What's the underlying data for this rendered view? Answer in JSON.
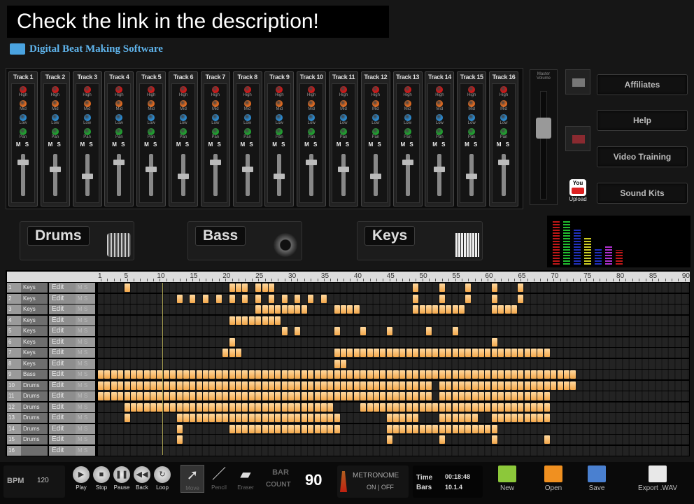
{
  "banner": "Check the link in the description!",
  "app_title": "Digital Beat Making Software",
  "mixer": {
    "tracks": [
      "Track 1",
      "Track 2",
      "Track 3",
      "Track 4",
      "Track 5",
      "Track 6",
      "Track 7",
      "Track 8",
      "Track 9",
      "Track 10",
      "Track 11",
      "Track 12",
      "Track 13",
      "Track 14",
      "Track 15",
      "Track 16"
    ],
    "knobs": [
      "High",
      "Mid",
      "Low",
      "Pan"
    ],
    "knob_colors": [
      "#d01818",
      "#e06a20",
      "#2a8ad0",
      "#20a030"
    ],
    "ms": "M S",
    "master_label": "Master Volume"
  },
  "menu": [
    "Affiliates",
    "Help",
    "Video Training",
    "Sound Kits"
  ],
  "upload": {
    "icon": "You",
    "label": "Upload"
  },
  "instruments": [
    "Drums",
    "Bass",
    "Keys"
  ],
  "spectrum": {
    "levels": [
      0.88,
      0.9,
      0.75,
      0.55,
      0.35,
      0.4,
      0.3
    ],
    "colors": [
      "#c01818",
      "#20c030",
      "#2030c0",
      "#d0d020",
      "#2030c0",
      "#b030d0",
      "#c01818"
    ]
  },
  "sequencer": {
    "ruler_ticks": [
      "1",
      "5",
      "10",
      "15",
      "20",
      "25",
      "30",
      "35",
      "40",
      "45",
      "50",
      "55",
      "60",
      "65",
      "70",
      "75",
      "80",
      "85",
      "90"
    ],
    "edit_label": "Edit",
    "ms_label": "M S",
    "tracks": [
      {
        "num": "1",
        "name": "Keys",
        "notes": [
          5,
          21,
          22,
          23,
          25,
          26,
          27,
          49,
          53,
          57,
          61,
          65
        ]
      },
      {
        "num": "2",
        "name": "Keys",
        "notes": [
          13,
          15,
          17,
          19,
          21,
          23,
          25,
          27,
          29,
          31,
          33,
          35,
          49,
          53,
          57,
          61,
          65
        ]
      },
      {
        "num": "3",
        "name": "Keys",
        "ranges": [
          [
            25,
            32
          ],
          [
            37,
            40
          ],
          [
            49,
            56
          ],
          [
            61,
            64
          ]
        ]
      },
      {
        "num": "4",
        "name": "Keys",
        "ranges": [
          [
            21,
            28
          ]
        ]
      },
      {
        "num": "5",
        "name": "Keys",
        "notes": [
          29,
          31,
          37,
          41,
          45,
          51,
          55
        ]
      },
      {
        "num": "6",
        "name": "Keys",
        "notes": [
          21,
          61
        ]
      },
      {
        "num": "7",
        "name": "Keys",
        "ranges": [
          [
            20,
            22
          ],
          [
            37,
            69
          ]
        ]
      },
      {
        "num": "8",
        "name": "Keys",
        "ranges": [
          [
            37,
            38
          ]
        ]
      },
      {
        "num": "9",
        "name": "Bass",
        "ranges": [
          [
            1,
            73
          ]
        ]
      },
      {
        "num": "10",
        "name": "Drums",
        "ranges": [
          [
            1,
            51
          ],
          [
            53,
            73
          ]
        ]
      },
      {
        "num": "11",
        "name": "Drums",
        "ranges": [
          [
            1,
            51
          ],
          [
            53,
            69
          ]
        ]
      },
      {
        "num": "12",
        "name": "Drums",
        "ranges": [
          [
            5,
            36
          ],
          [
            41,
            69
          ]
        ]
      },
      {
        "num": "13",
        "name": "Drums",
        "ranges": [
          [
            5,
            5
          ],
          [
            13,
            37
          ],
          [
            45,
            49
          ],
          [
            53,
            58
          ],
          [
            61,
            69
          ]
        ]
      },
      {
        "num": "14",
        "name": "Drums",
        "ranges": [
          [
            13,
            13
          ],
          [
            21,
            37
          ],
          [
            45,
            61
          ]
        ]
      },
      {
        "num": "15",
        "name": "Drums",
        "notes": [
          13,
          45,
          53,
          61,
          69
        ]
      },
      {
        "num": "16",
        "name": "",
        "notes": []
      }
    ]
  },
  "bottom": {
    "bpm_label": "BPM",
    "bpm": "120",
    "transport": [
      {
        "label": "Play",
        "g": "▶"
      },
      {
        "label": "Stop",
        "g": "■"
      },
      {
        "label": "Pause",
        "g": "❚❚"
      },
      {
        "label": "Back",
        "g": "◀◀"
      },
      {
        "label": "Loop",
        "g": "↻"
      }
    ],
    "tools": [
      {
        "label": "Move",
        "g": "➚"
      },
      {
        "label": "Pencil",
        "g": "／"
      },
      {
        "label": "Eraser",
        "g": "▰"
      }
    ],
    "bar_count_label1": "BAR",
    "bar_count_label2": "COUNT",
    "bar_count": "90",
    "metronome": "METRONOME",
    "metronome_state": "ON | OFF",
    "time_label": "Time",
    "time": "00:18:48",
    "bars_label": "Bars",
    "bars": "10.1.4",
    "files": [
      {
        "label": "New",
        "color": "#8cc83a"
      },
      {
        "label": "Open",
        "color": "#f09020"
      },
      {
        "label": "Save",
        "color": "#4a80d0"
      },
      {
        "label": "Export .WAV",
        "color": "#e8e8e8"
      }
    ]
  }
}
